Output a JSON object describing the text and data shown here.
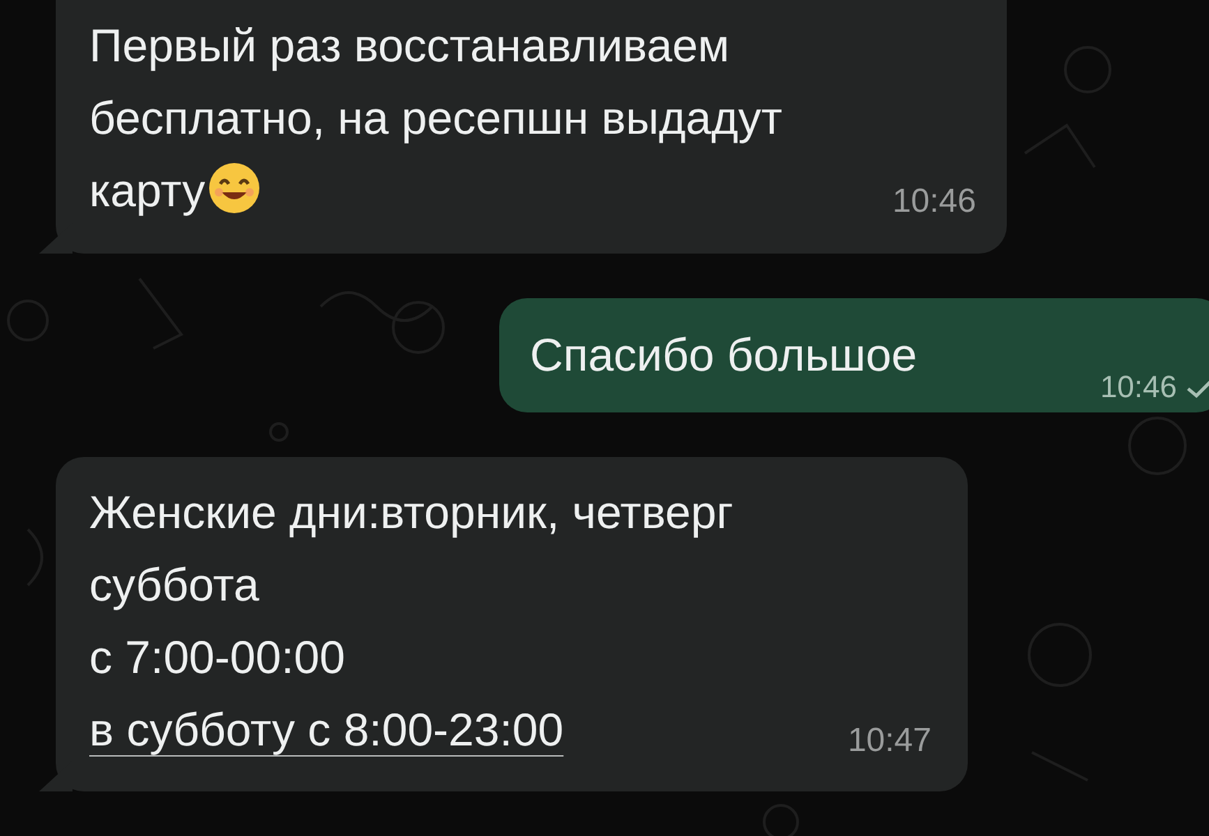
{
  "messages": [
    {
      "outgoing": false,
      "lines": [
        {
          "text": "Первый раз восстанавливаем",
          "kind": "text"
        },
        {
          "text": "бесплатно, на ресепшн выдадут",
          "kind": "text"
        },
        {
          "text": "карту",
          "kind": "text_emoji"
        }
      ],
      "time": "10:46"
    },
    {
      "outgoing": true,
      "lines": [
        {
          "text": "Спасибо большое",
          "kind": "text"
        }
      ],
      "time": "10:46",
      "read": false
    },
    {
      "outgoing": false,
      "lines": [
        {
          "text": "Женские дни:вторник, четверг",
          "kind": "text"
        },
        {
          "text": "суббота",
          "kind": "text"
        },
        {
          "text": "с 7:00-00:00",
          "kind": "text"
        },
        {
          "text": "в субботу с 8:00-23:00",
          "kind": "link"
        }
      ],
      "time": "10:47"
    }
  ]
}
